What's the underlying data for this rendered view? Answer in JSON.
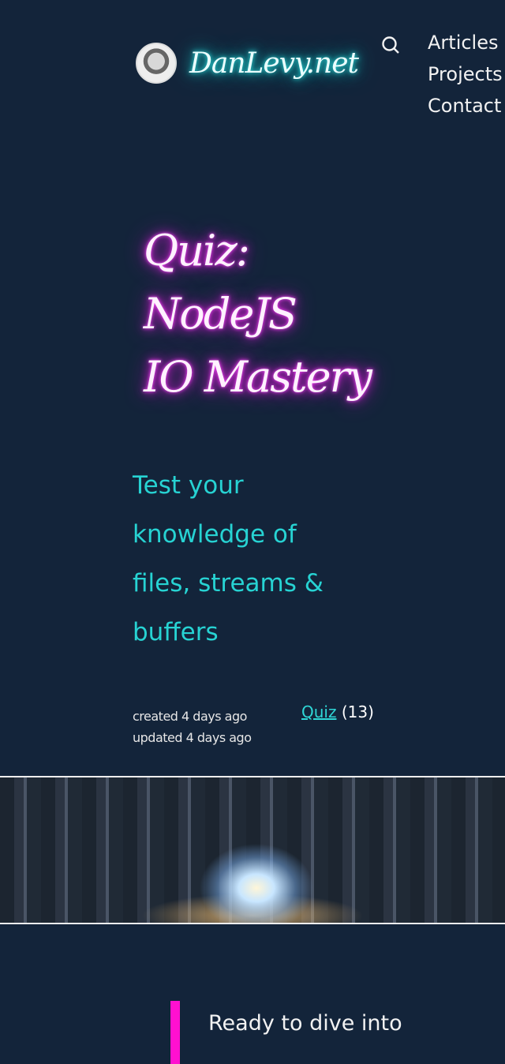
{
  "header": {
    "logo_text": "DanLevy.net",
    "search_icon": "search-icon",
    "nav": [
      "Articles",
      "Projects",
      "Contact"
    ]
  },
  "hero": {
    "title_lines": [
      "Quiz:",
      "NodeJS",
      "IO Mastery"
    ],
    "subtitle": "Test your knowledge of files, streams & buffers",
    "created": "created 4 days ago",
    "updated": "updated 4 days ago",
    "tag_label": "Quiz",
    "tag_count": "(13)"
  },
  "content": {
    "intro": "Ready to dive into"
  },
  "colors": {
    "background": "#13243a",
    "accent_cyan": "#27d3d3",
    "accent_magenta": "#ff10d0"
  }
}
